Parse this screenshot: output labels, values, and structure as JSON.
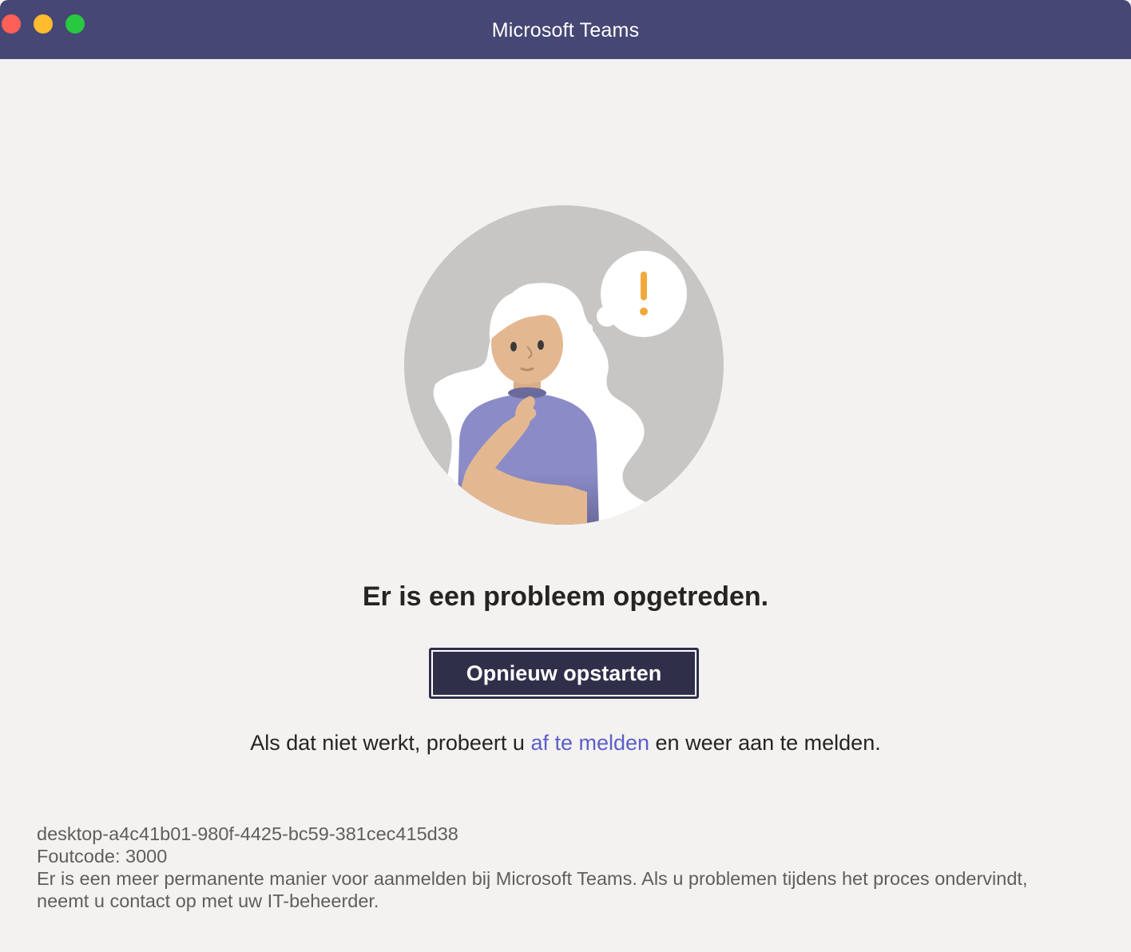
{
  "window": {
    "title": "Microsoft Teams",
    "colors": {
      "titlebar": "#464775",
      "background": "#f3f2f1",
      "button": "#2f2f4a",
      "link": "#5b5fc7"
    }
  },
  "main": {
    "illustration_icon": "thinking-woman-alert-illustration",
    "heading": "Er is een probleem opgetreden.",
    "restart_button": "Opnieuw opstarten",
    "hint_before": "Als dat niet werkt, probeert u ",
    "hint_link": "af te melden",
    "hint_after": " en weer aan te melden."
  },
  "details": {
    "session_id": "desktop-a4c41b01-980f-4425-bc59-381cec415d38",
    "error_code": "Foutcode: 3000",
    "message_line1": "Er is een meer permanente manier voor aanmelden bij Microsoft Teams. Als u problemen tijdens het proces ondervindt,",
    "message_line2": "neemt u contact op met uw IT-beheerder."
  }
}
